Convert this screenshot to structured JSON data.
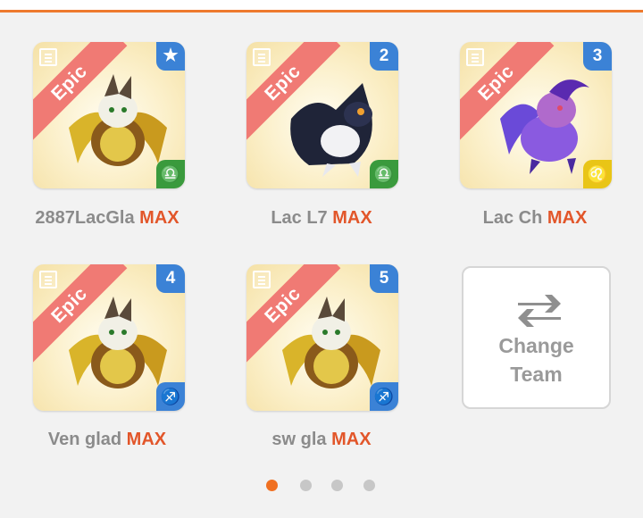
{
  "colors": {
    "accent": "#ee7a2e",
    "epic_ribbon": "#f07a74",
    "badge_blue": "#3b82d6",
    "libra_green": "#3a9a3d",
    "leo_yellow": "#e9c516",
    "max_orange": "#e2562a"
  },
  "cards": [
    {
      "rarity": "Epic",
      "slot": "★",
      "slot_icon": "star-icon",
      "sign_icon": "libra-icon",
      "sign_glyph": "♎",
      "name": "2887LacGla",
      "level": "MAX"
    },
    {
      "rarity": "Epic",
      "slot": "2",
      "sign_icon": "libra-icon",
      "sign_glyph": "♎",
      "name": "Lac L7",
      "level": "MAX"
    },
    {
      "rarity": "Epic",
      "slot": "3",
      "sign_icon": "leo-icon",
      "sign_glyph": "♌",
      "name": "Lac Ch",
      "level": "MAX"
    },
    {
      "rarity": "Epic",
      "slot": "4",
      "sign_icon": "sagittarius-icon",
      "sign_glyph": "♐",
      "name": "Ven glad",
      "level": "MAX"
    },
    {
      "rarity": "Epic",
      "slot": "5",
      "sign_icon": "sagittarius-icon",
      "sign_glyph": "♐",
      "name": "sw gla",
      "level": "MAX"
    }
  ],
  "change_team": {
    "line1": "Change",
    "line2": "Team"
  },
  "pagination": {
    "total": 4,
    "current": 1
  }
}
